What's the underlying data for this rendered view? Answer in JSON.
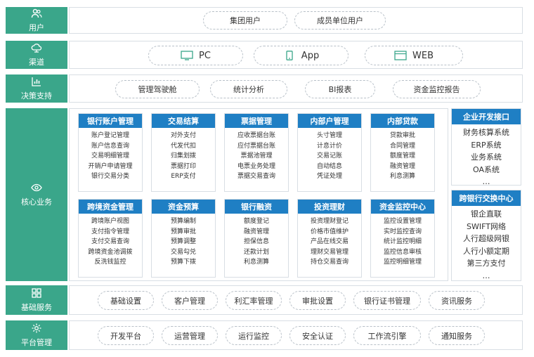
{
  "user_layer": {
    "label": "用户",
    "items": [
      "集团用户",
      "成员单位用户"
    ]
  },
  "channel_layer": {
    "label": "渠道",
    "items": [
      "PC",
      "App",
      "WEB"
    ]
  },
  "decision_layer": {
    "label": "决策支持",
    "items": [
      "管理驾驶舱",
      "统计分析",
      "BI报表",
      "资金监控报告"
    ]
  },
  "core_layer": {
    "label": "核心业务",
    "row1": [
      {
        "title": "银行账户管理",
        "items": [
          "账户登记管理",
          "账户信息查询",
          "交易明细管理",
          "开销户申请管理",
          "银行交易分类"
        ]
      },
      {
        "title": "交易结算",
        "items": [
          "对外支付",
          "代发代扣",
          "归集划拨",
          "票据打印",
          "ERP支付"
        ]
      },
      {
        "title": "票据管理",
        "items": [
          "应收票据台账",
          "应付票据台账",
          "票据池管理",
          "电票业务处理",
          "票据交易查询"
        ]
      },
      {
        "title": "内部户管理",
        "items": [
          "头寸管理",
          "计息计价",
          "交易记账",
          "自动结息",
          "凭证处理"
        ]
      },
      {
        "title": "内部贷款",
        "items": [
          "贷款审批",
          "合同管理",
          "额度管理",
          "融资管理",
          "利息测算"
        ]
      }
    ],
    "row2": [
      {
        "title": "跨境资金管理",
        "items": [
          "跨境账户视图",
          "支付指令管理",
          "支付交易查询",
          "跨境资金池调拨",
          "反洗钱监控"
        ]
      },
      {
        "title": "资金预算",
        "items": [
          "预算编制",
          "预算审批",
          "预算调整",
          "交易勾兑",
          "预算下拨"
        ]
      },
      {
        "title": "银行融资",
        "items": [
          "额度登记",
          "融资管理",
          "担保信息",
          "还款计划",
          "利息测算"
        ]
      },
      {
        "title": "投资理财",
        "items": [
          "投资理财登记",
          "价格市值维护",
          "产品在线交易",
          "理财交易管理",
          "持仓交易查询"
        ]
      },
      {
        "title": "资金监控中心",
        "items": [
          "监控设置管理",
          "实时监控查询",
          "统计监控明细",
          "监控信息审核",
          "监控明细管理"
        ]
      }
    ],
    "side1": {
      "title": "企业开发接口",
      "items": [
        "财务核算系统",
        "ERP系统",
        "业务系统",
        "OA系统",
        "…"
      ]
    },
    "side2": {
      "title": "跨银行交换中心",
      "items": [
        "银企直联",
        "SWIFT网络",
        "人行超级网银",
        "人行小额定期",
        "第三方支付",
        "…"
      ]
    }
  },
  "base_layer": {
    "label": "基础服务",
    "items": [
      "基础设置",
      "客户管理",
      "利汇率管理",
      "审批设置",
      "银行证书管理",
      "资讯服务"
    ]
  },
  "platform_layer": {
    "label": "平台管理",
    "items": [
      "开发平台",
      "运营管理",
      "运行监控",
      "安全认证",
      "工作流引擎",
      "通知服务"
    ]
  },
  "colors": {
    "label_bg": "#3aa68a",
    "header_bg": "#1f7fc4",
    "border": "#d8dee4"
  }
}
